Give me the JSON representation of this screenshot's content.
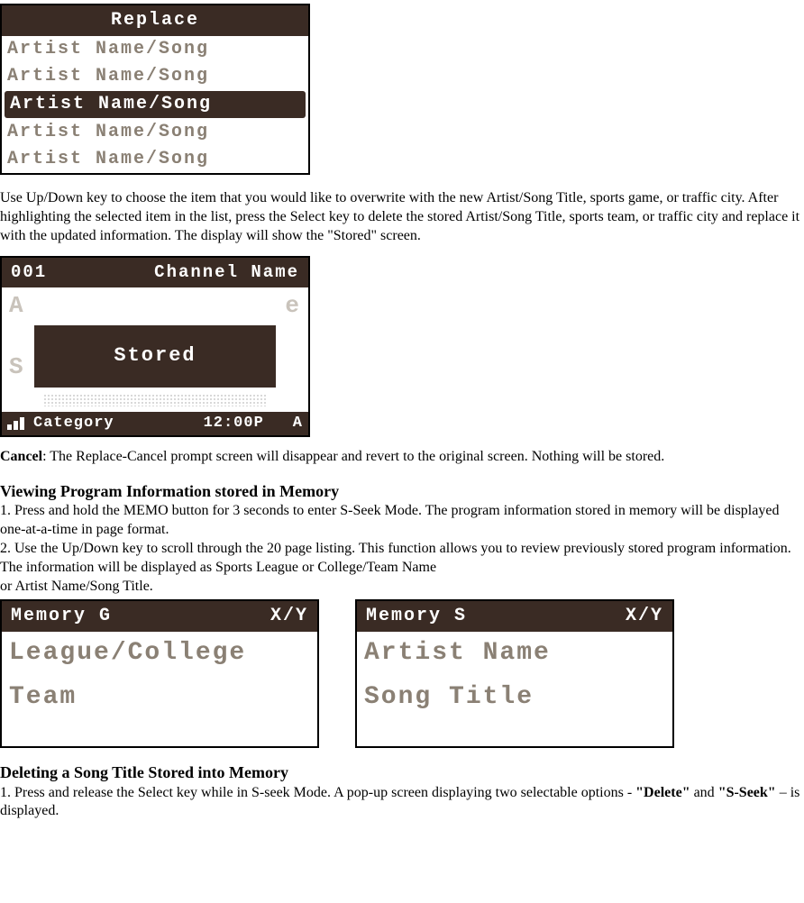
{
  "replace_screen": {
    "title": "Replace",
    "rows": [
      {
        "text": "Artist Name/Song",
        "selected": false
      },
      {
        "text": "Artist Name/Song",
        "selected": false
      },
      {
        "text": "Artist Name/Song",
        "selected": true
      },
      {
        "text": "Artist Name/Song",
        "selected": false
      },
      {
        "text": "Artist Name/Song",
        "selected": false
      }
    ]
  },
  "para1": "Use Up/Down key to choose the item that you would like to overwrite with the new Artist/Song Title, sports game, or traffic city. After highlighting the selected item in the list, press the Select key to delete the stored Artist/Song Title, sports team, or traffic city and replace it with the updated information. The display will show the \"Stored\" screen.",
  "stored_screen": {
    "channel_num": "001",
    "channel_label": "Channel Name",
    "overlay": "Stored",
    "footer_category": "Category",
    "footer_time": "12:00P",
    "footer_mode": "A"
  },
  "cancel_label": "Cancel",
  "cancel_text": ": The Replace-Cancel prompt screen will disappear and revert to the original screen. Nothing will be stored.",
  "section_view": "Viewing Program Information stored in Memory",
  "view_step1": "1. Press and hold the MEMO button for 3 seconds to enter S-Seek Mode. The program information stored in memory will be displayed one-at-a-time in page format.",
  "view_step2": "2. Use the Up/Down key to scroll through the 20 page listing. This function allows you to review previously stored program information. The information will be displayed as Sports League or College/Team Name",
  "view_step2b": "or Artist Name/Song Title.",
  "memory_screen_g": {
    "header_left": "Memory G",
    "header_right": "X/Y",
    "line1": "League/College",
    "line2": "Team"
  },
  "memory_screen_s": {
    "header_left": "Memory S",
    "header_right": "X/Y",
    "line1": "Artist Name",
    "line2": "Song Title"
  },
  "section_delete": "Deleting a Song Title Stored into Memory",
  "delete_step1_a": "1. Press and release the Select key while in S-seek Mode. A pop-up screen displaying two selectable options - ",
  "delete_bold1": "\"Delete\"",
  "delete_step1_b": " and ",
  "delete_bold2": "\"S-Seek\"",
  "delete_step1_c": " – is displayed."
}
